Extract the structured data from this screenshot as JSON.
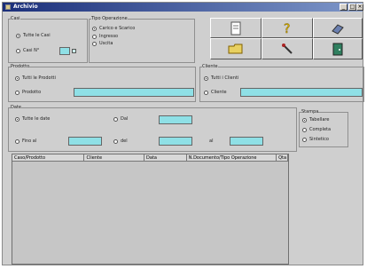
{
  "window": {
    "title": "Archivio"
  },
  "caso": {
    "title": "Casi",
    "tutte": "Tutte le Casi",
    "casi_n": "Casi N°"
  },
  "tipo_op": {
    "title": "Tipo Operazione",
    "items": [
      "Carico e Scarico",
      "Ingresso",
      "Uscita"
    ]
  },
  "prodotti": {
    "title": "Prodotto",
    "tutti": "Tutti le Prodotti",
    "prodotto": "Prodotto"
  },
  "clienti": {
    "title": "Cliente",
    "tutti": "Tutti i Clienti",
    "cliente": "Cliente"
  },
  "date": {
    "title": "Date",
    "tutte": "Tutte le date",
    "dal": "Dal",
    "fino": "Fino al",
    "del": "del",
    "al": "al"
  },
  "stampa": {
    "title": "Stampa",
    "items": [
      "Tabellare",
      "Completa",
      "Sintetico"
    ]
  },
  "table": {
    "columns": [
      "Caso/Prodotto",
      "Cliente",
      "Data",
      "N.Documento/Tipo Operazione",
      "Qta"
    ]
  },
  "icons": [
    "page-icon",
    "help-icon",
    "eraser-icon",
    "open-folder-icon",
    "pen-icon",
    "exit-door-icon"
  ]
}
